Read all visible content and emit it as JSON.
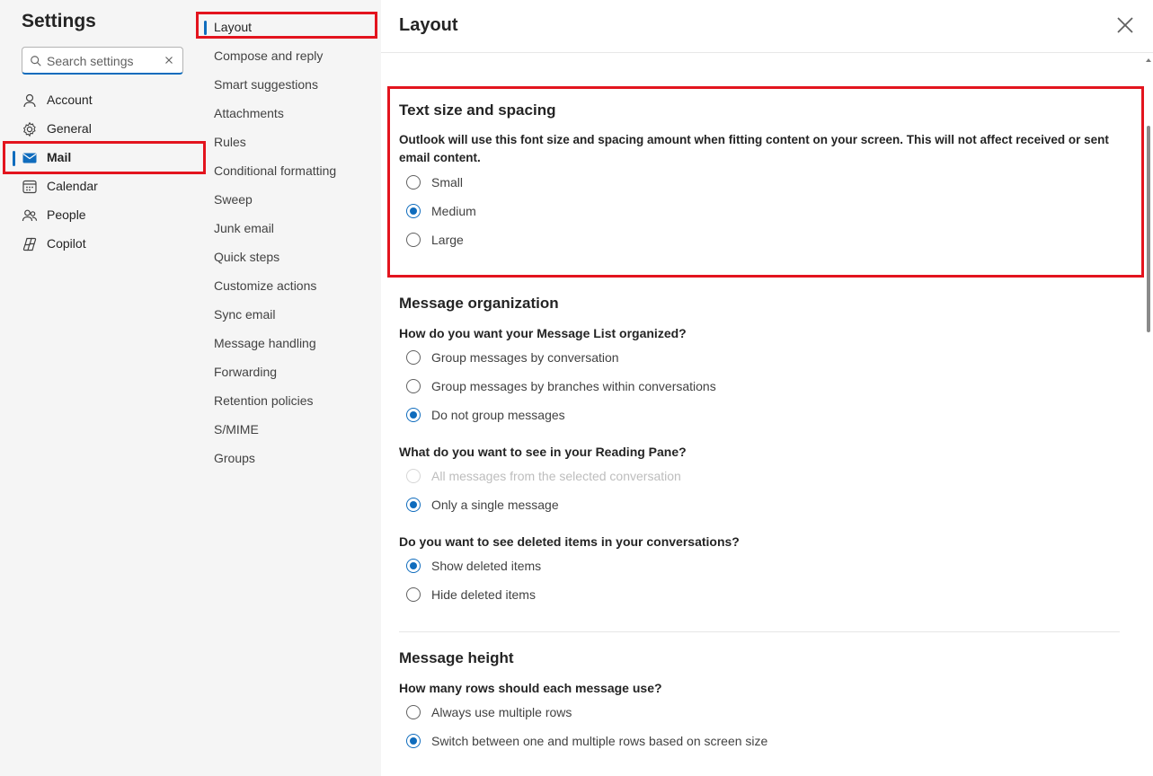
{
  "settings_title": "Settings",
  "search": {
    "placeholder": "Search settings"
  },
  "categories": [
    {
      "label": "Account",
      "icon": "person-icon"
    },
    {
      "label": "General",
      "icon": "gear-icon"
    },
    {
      "label": "Mail",
      "icon": "mail-icon",
      "selected": true
    },
    {
      "label": "Calendar",
      "icon": "calendar-icon"
    },
    {
      "label": "People",
      "icon": "people-icon"
    },
    {
      "label": "Copilot",
      "icon": "copilot-icon"
    }
  ],
  "mail_sections": [
    "Layout",
    "Compose and reply",
    "Smart suggestions",
    "Attachments",
    "Rules",
    "Conditional formatting",
    "Sweep",
    "Junk email",
    "Quick steps",
    "Customize actions",
    "Sync email",
    "Message handling",
    "Forwarding",
    "Retention policies",
    "S/MIME",
    "Groups"
  ],
  "panel": {
    "title": "Layout",
    "text_size": {
      "heading": "Text size and spacing",
      "description": "Outlook will use this font size and spacing amount when fitting content on your screen. This will not affect received or sent email content.",
      "options": [
        "Small",
        "Medium",
        "Large"
      ],
      "selected": "Medium"
    },
    "message_org": {
      "heading": "Message organization",
      "q1": "How do you want your Message List organized?",
      "q1_options": [
        "Group messages by conversation",
        "Group messages by branches within conversations",
        "Do not group messages"
      ],
      "q1_selected": "Do not group messages",
      "q2": "What do you want to see in your Reading Pane?",
      "q2_options": [
        "All messages from the selected conversation",
        "Only a single message"
      ],
      "q2_selected": "Only a single message",
      "q3": "Do you want to see deleted items in your conversations?",
      "q3_options": [
        "Show deleted items",
        "Hide deleted items"
      ],
      "q3_selected": "Show deleted items"
    },
    "message_height": {
      "heading": "Message height",
      "q": "How many rows should each message use?",
      "options": [
        "Always use multiple rows",
        "Switch between one and multiple rows based on screen size"
      ],
      "selected": "Switch between one and multiple rows based on screen size"
    }
  },
  "colors": {
    "accent": "#0f6cbd",
    "highlight": "#e3141e",
    "pane_bg": "#f5f5f5"
  }
}
